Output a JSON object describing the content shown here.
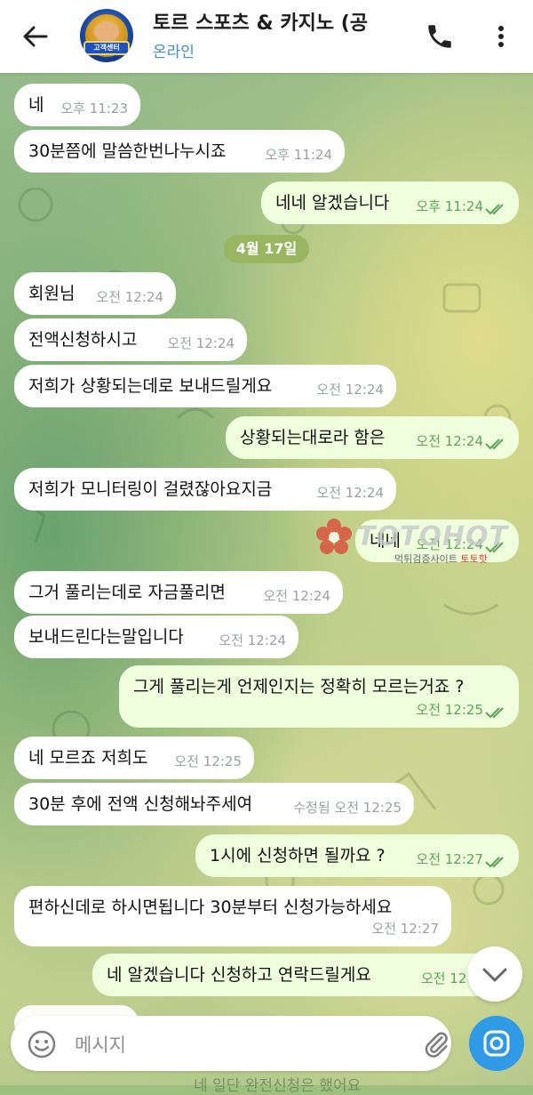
{
  "header": {
    "title": "토르 스포츠 & 카지노 (공",
    "status": "온라인",
    "avatar_text": "고객센터"
  },
  "date_separator": "4월 17일",
  "messages": [
    {
      "dir": "in",
      "text": "네",
      "time": "오후 11:23"
    },
    {
      "dir": "in",
      "text": "30분쯤에 말씀한번나누시죠",
      "time": "오후 11:24"
    },
    {
      "dir": "out",
      "text": "네네 알겠습니다",
      "time": "오후 11:24"
    },
    {
      "dir": "in",
      "text": "회원님",
      "time": "오전 12:24"
    },
    {
      "dir": "in",
      "text": "전액신청하시고",
      "time": "오전 12:24"
    },
    {
      "dir": "in",
      "text": "저희가 상황되는데로 보내드릴게요",
      "time": "오전 12:24"
    },
    {
      "dir": "out",
      "text": "상황되는대로라 함은",
      "time": "오전 12:24"
    },
    {
      "dir": "in",
      "text": "저희가 모니터링이 걸렸잖아요지금",
      "time": "오전 12:24"
    },
    {
      "dir": "out",
      "text": "네네",
      "time": "오전 12:24"
    },
    {
      "dir": "in",
      "text": "그거 풀리는데로 자금풀리면",
      "time": "오전 12:24"
    },
    {
      "dir": "in",
      "text": "보내드린다는말입니다",
      "time": "오전 12:24"
    },
    {
      "dir": "out",
      "text": "그게 풀리는게 언제인지는 정확히 모르는거죠 ?",
      "time": "오전 12:25"
    },
    {
      "dir": "in",
      "text": "네 모르죠 저희도",
      "time": "오전 12:25"
    },
    {
      "dir": "in",
      "text": "30분 후에 전액 신청해놔주세여",
      "time": "수정됨 오전 12:25"
    },
    {
      "dir": "out",
      "text": "1시에 신청하면 될까요 ?",
      "time": "오전 12:27"
    },
    {
      "dir": "in",
      "text": "편하신데로 하시면됩니다 30분부터 신청가능하세요",
      "time": "오전 12:27"
    },
    {
      "dir": "out",
      "text": "네 알겠습니다 신청하고 연락드릴게요",
      "time": "오전 12:2"
    }
  ],
  "watermark": {
    "brand": "TOTOHOT",
    "sub_plain": "먹튀검증사이트",
    "sub_red": "토토핫"
  },
  "composer": {
    "placeholder": "메시지"
  },
  "bottom_partial_text": "네 일단 완전신청은 했어요",
  "colors": {
    "header_bg": "#ffffff",
    "status_blue": "#3d8fd1",
    "incoming_bubble": "#ffffff",
    "outgoing_bubble": "#effedd",
    "outgoing_meta": "#5fa356",
    "date_chip": "#9ab55f",
    "camera_button": "#2f9ae6",
    "watermark_red": "#e0442f"
  },
  "icons": {
    "back": "arrow-left-icon",
    "phone": "phone-icon",
    "menu": "more-vert-icon",
    "emoji": "emoji-icon",
    "attach": "paperclip-icon",
    "camera": "camera-icon",
    "scroll": "chevron-down-icon",
    "read": "double-check-icon"
  }
}
